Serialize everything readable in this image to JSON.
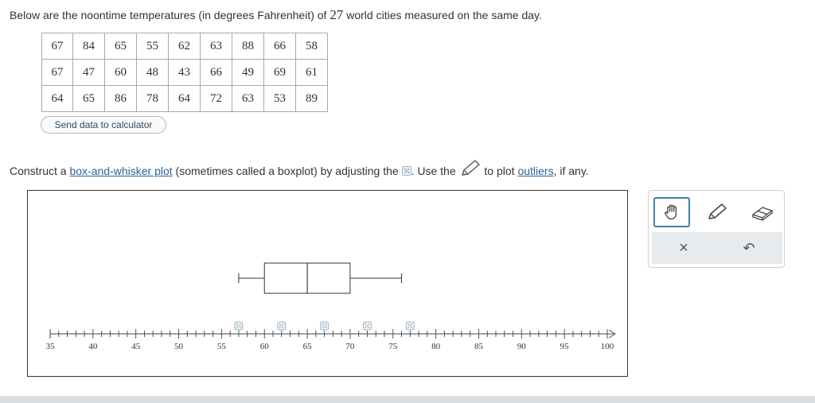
{
  "intro": {
    "before": "Below are the noontime temperatures (in degrees Fahrenheit) of ",
    "count": "27",
    "after": " world cities measured on the same day."
  },
  "table": {
    "rows": [
      [
        "67",
        "84",
        "65",
        "55",
        "62",
        "63",
        "88",
        "66",
        "58"
      ],
      [
        "67",
        "47",
        "60",
        "48",
        "43",
        "66",
        "49",
        "69",
        "61"
      ],
      [
        "64",
        "65",
        "86",
        "78",
        "64",
        "72",
        "63",
        "53",
        "89"
      ]
    ]
  },
  "send_button": "Send data to calculator",
  "instruction": {
    "part1": "Construct a ",
    "link1": "box-and-whisker plot",
    "part2": " (sometimes called a boxplot) by adjusting the ",
    "part3": ". Use the ",
    "part4": " to plot ",
    "link2": "outliers",
    "part5": ", if any."
  },
  "plot": {
    "axis_min": 35,
    "axis_max": 100,
    "tick_labels": [
      "35",
      "40",
      "45",
      "50",
      "55",
      "60",
      "65",
      "70",
      "75",
      "80",
      "85",
      "90",
      "95",
      "100"
    ],
    "box": {
      "whisker_low": 57,
      "q1": 60,
      "median": 65,
      "q3": 70,
      "whisker_high": 76
    },
    "handle_positions": [
      57,
      62,
      67,
      72,
      77
    ]
  },
  "tools": {
    "items": [
      {
        "icon": "hand-icon",
        "selected": true
      },
      {
        "icon": "pencil-icon",
        "selected": false
      },
      {
        "icon": "eraser-icon",
        "selected": false
      }
    ],
    "actions": [
      {
        "icon": "close-icon",
        "glyph": "×"
      },
      {
        "icon": "undo-icon",
        "glyph": "↶"
      }
    ]
  },
  "colors": {
    "accent": "#3f83a8",
    "link": "#2a6496",
    "toolbar_bg": "#e8ebee"
  }
}
